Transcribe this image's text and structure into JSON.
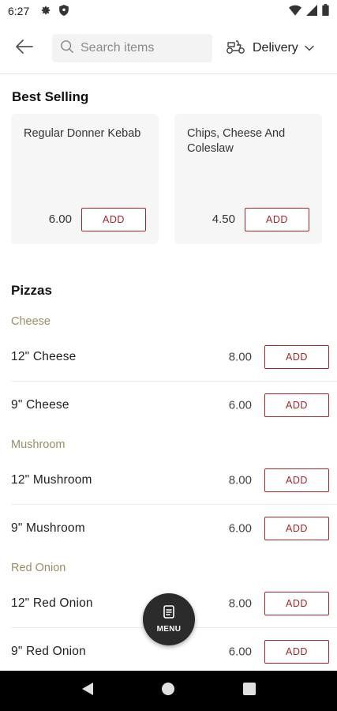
{
  "status_bar": {
    "time": "6:27",
    "icons": [
      "gear-icon",
      "shield-icon",
      "wifi-icon",
      "signal-icon",
      "battery-icon"
    ]
  },
  "header": {
    "search_placeholder": "Search items",
    "delivery_label": "Delivery"
  },
  "best_selling": {
    "title": "Best Selling",
    "cards": [
      {
        "name": "Regular Donner Kebab",
        "price": "6.00",
        "add_label": "ADD"
      },
      {
        "name": "Chips, Cheese And Coleslaw",
        "price": "4.50",
        "add_label": "ADD"
      }
    ]
  },
  "pizzas": {
    "title": "Pizzas",
    "categories": [
      {
        "label": "Cheese",
        "items": [
          {
            "name": "12\" Cheese",
            "price": "8.00",
            "add_label": "ADD"
          },
          {
            "name": "9\" Cheese",
            "price": "6.00",
            "add_label": "ADD"
          }
        ]
      },
      {
        "label": "Mushroom",
        "items": [
          {
            "name": "12\" Mushroom",
            "price": "8.00",
            "add_label": "ADD"
          },
          {
            "name": "9\" Mushroom",
            "price": "6.00",
            "add_label": "ADD"
          }
        ]
      },
      {
        "label": "Red Onion",
        "items": [
          {
            "name": "12\" Red Onion",
            "price": "8.00",
            "add_label": "ADD"
          },
          {
            "name": "9\" Red Onion",
            "price": "6.00",
            "add_label": "ADD"
          }
        ]
      }
    ]
  },
  "menu_fab": {
    "label": "MENU"
  },
  "colors": {
    "accent": "#a3262a",
    "category": "#9c8d63",
    "card_bg": "#f6f6f6",
    "fab_bg": "#2b2b2b"
  }
}
